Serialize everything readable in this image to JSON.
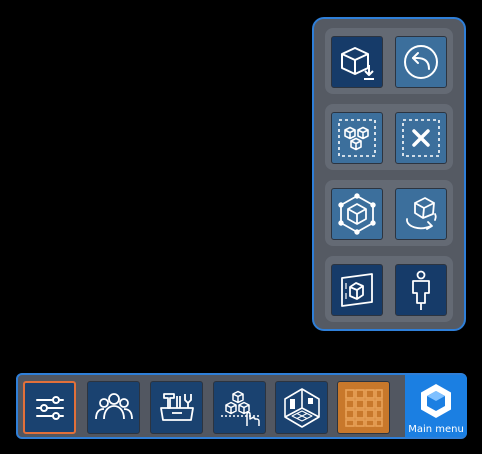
{
  "side_panel": {
    "groups": [
      {
        "left": {
          "icon": "box-download-icon",
          "tone": "dark"
        },
        "right": {
          "icon": "undo-circle-icon",
          "tone": "light"
        }
      },
      {
        "left": {
          "icon": "multi-select-boxes-icon",
          "tone": "light"
        },
        "right": {
          "icon": "deselect-icon",
          "tone": "light"
        }
      },
      {
        "left": {
          "icon": "box-frame-icon",
          "tone": "light"
        },
        "right": {
          "icon": "rotate-box-icon",
          "tone": "light"
        }
      },
      {
        "left": {
          "icon": "screen-box-icon",
          "tone": "dark"
        },
        "right": {
          "icon": "person-pin-icon",
          "tone": "dark"
        }
      }
    ]
  },
  "toolbar": {
    "buttons": [
      {
        "icon": "sliders-icon",
        "selected": true
      },
      {
        "icon": "users-icon"
      },
      {
        "icon": "toolbox-icon"
      },
      {
        "icon": "boxes-hand-icon"
      },
      {
        "icon": "room-plan-icon"
      },
      {
        "icon": "grid-icon"
      }
    ],
    "main_menu_label": "Main menu",
    "colors": {
      "accent": "#1b7fe2",
      "selected_border": "#e2703a",
      "grid_button": "#c8782b"
    }
  }
}
